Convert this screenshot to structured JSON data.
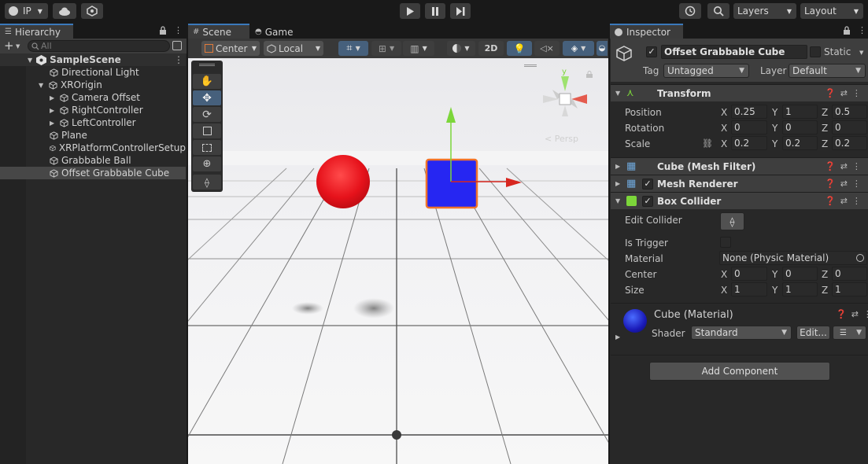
{
  "toolbar": {
    "account_label": "IP",
    "layers_label": "Layers",
    "layout_label": "Layout"
  },
  "hierarchy": {
    "tab_label": "Hierarchy",
    "search_placeholder": "All",
    "scene_name": "SampleScene",
    "items": [
      {
        "label": "Directional Light"
      },
      {
        "label": "XROrigin"
      },
      {
        "label": "Camera Offset"
      },
      {
        "label": "RightController"
      },
      {
        "label": "LeftController"
      },
      {
        "label": "Plane"
      },
      {
        "label": "XRPlatformControllerSetup"
      },
      {
        "label": "Grabbable Ball"
      },
      {
        "label": "Offset Grabbable Cube"
      }
    ]
  },
  "scene": {
    "tab_scene": "Scene",
    "tab_game": "Game",
    "pivot_label": "Center",
    "space_label": "Local",
    "mode_2d": "2D",
    "persp_label": "< Persp",
    "gizmo_y": "y"
  },
  "inspector": {
    "tab_label": "Inspector",
    "object_name": "Offset Grabbable Cube",
    "static_label": "Static",
    "tag_label": "Tag",
    "tag_value": "Untagged",
    "layer_label": "Layer",
    "layer_value": "Default",
    "transform": {
      "title": "Transform",
      "position_label": "Position",
      "rotation_label": "Rotation",
      "scale_label": "Scale",
      "position": {
        "x": "0.25",
        "y": "1",
        "z": "0.5"
      },
      "rotation": {
        "x": "0",
        "y": "0",
        "z": "0"
      },
      "scale": {
        "x": "0.2",
        "y": "0.2",
        "z": "0.2"
      }
    },
    "mesh_filter_title": "Cube (Mesh Filter)",
    "mesh_renderer_title": "Mesh Renderer",
    "box_collider": {
      "title": "Box Collider",
      "edit_collider_label": "Edit Collider",
      "is_trigger_label": "Is Trigger",
      "material_label": "Material",
      "material_value": "None (Physic Material)",
      "center_label": "Center",
      "size_label": "Size",
      "center": {
        "x": "0",
        "y": "0",
        "z": "0"
      },
      "size": {
        "x": "1",
        "y": "1",
        "z": "1"
      }
    },
    "material": {
      "name": "Cube (Material)",
      "shader_label": "Shader",
      "shader_value": "Standard",
      "edit_label": "Edit..."
    },
    "add_component_label": "Add Component",
    "axis": {
      "x": "X",
      "y": "Y",
      "z": "Z"
    }
  },
  "colors": {
    "accent": "#3a79bb",
    "panel_bg": "#282828",
    "header_bg": "#3e3e3e",
    "sphere_red": "#e6121b",
    "cube_blue": "#2626f2",
    "selection_orange": "#f0732b",
    "gizmo_green": "#7cd63a",
    "gizmo_red": "#d7261f"
  }
}
